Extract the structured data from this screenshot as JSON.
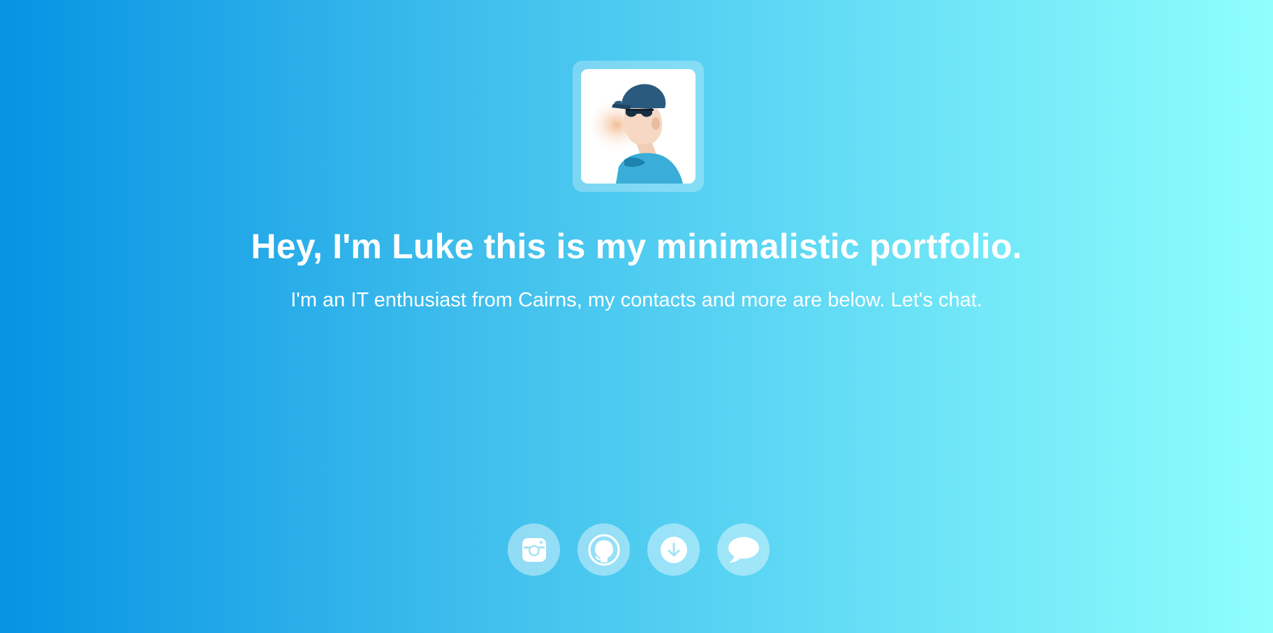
{
  "profile": {
    "avatar_alt": "Illustrated portrait of a man in a cap and sunglasses"
  },
  "hero": {
    "title": "Hey, I'm Luke this is my minimalistic portfolio.",
    "subtitle": "I'm an IT enthusiast from Cairns, my contacts and more are below. Let's chat."
  },
  "social": {
    "items": [
      {
        "icon": "instagram-icon"
      },
      {
        "icon": "github-icon"
      },
      {
        "icon": "download-icon"
      },
      {
        "icon": "chat-icon"
      }
    ]
  },
  "theme": {
    "gradient_start": "#0693e3",
    "gradient_end": "#8ffffc",
    "text_color": "#ffffff"
  }
}
